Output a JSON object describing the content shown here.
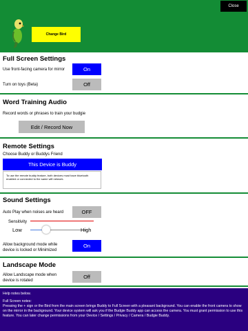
{
  "header": {
    "close_label": "Close",
    "change_bird_label": "Change Bird"
  },
  "full_screen": {
    "title": "Full Screen Settings",
    "camera_label": "Use front-facing camera for mirror",
    "camera_value": "On",
    "toys_label": "Turn on toys (Beta)",
    "toys_value": "Off"
  },
  "word_training": {
    "title": "Word Training Audio",
    "description": "Record words or phrases to train your budgie",
    "button_label": "Edit / Record Now"
  },
  "remote": {
    "title": "Remote Settings",
    "choose_label": "Choose Buddy or Buddys Friend",
    "device_button": "This Device is Buddy",
    "note": "To use the remote buddy feature, both devices must have bluetooth enabled or connected to the same wifi network."
  },
  "sound": {
    "title": "Sound Settings",
    "autoplay_label": "Auto Play when noises are heard",
    "autoplay_value": "OFF",
    "sensitivity_label": "Sensitivity",
    "sensitivity_low": "Low",
    "sensitivity_high": "High",
    "sensitivity_level": 0.28,
    "background_label": "Allow background mode while device is locked or Minimized",
    "background_value": "On"
  },
  "landscape": {
    "title": "Landscape Mode",
    "allow_label": "Allow Landscape mode when device is rotated",
    "allow_value": "Off"
  },
  "help": {
    "heading": "Help notes below.",
    "subheading": "Full Screen notes:",
    "body": "Pressing the + sign or the Bird from the main screen brings Buddy to Full Screen with a pleasant background. You can enable the front camera to show on the mirror in the background. Your device system will ask you if the Budgie Buddy app can access the camera. You must grant permission to use this feature. You can later change permissions from your Device / Settings / Privacy / Camera / Budgie Buddy."
  },
  "colors": {
    "header_green": "#138c35",
    "toggle_on": "#0000ff",
    "toggle_off": "#bbbbbb",
    "help_bg": "#2a0080",
    "change_bird_bg": "#ffff00"
  },
  "icons": {
    "bird": "budgie-bird-icon"
  }
}
